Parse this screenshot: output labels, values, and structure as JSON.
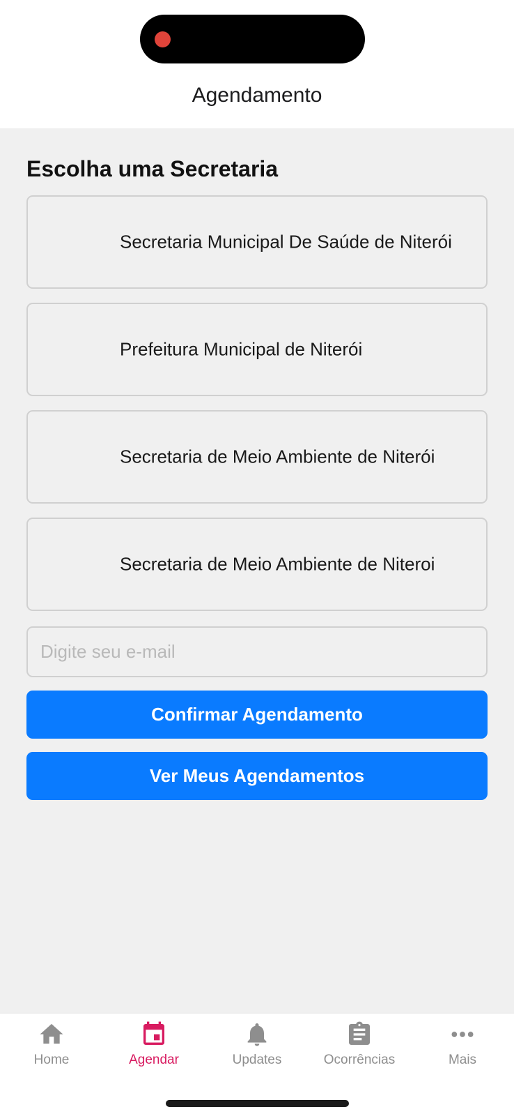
{
  "header": {
    "title": "Agendamento"
  },
  "main": {
    "section_title": "Escolha uma Secretaria",
    "secretarias": [
      {
        "label": "Secretaria Municipal De Saúde de Niterói"
      },
      {
        "label": "Prefeitura Municipal de Niterói"
      },
      {
        "label": "Secretaria de Meio Ambiente de Niterói"
      },
      {
        "label": "Secretaria de Meio Ambiente de Niteroi"
      }
    ],
    "email": {
      "value": "",
      "placeholder": "Digite seu e-mail"
    },
    "confirm_label": "Confirmar Agendamento",
    "view_label": "Ver Meus Agendamentos"
  },
  "tabbar": {
    "active": "Agendar",
    "active_color": "#d81b60",
    "inactive_color": "#8e8e8e",
    "tabs": [
      {
        "label": "Home",
        "icon": "home-icon"
      },
      {
        "label": "Agendar",
        "icon": "calendar-icon"
      },
      {
        "label": "Updates",
        "icon": "bell-icon"
      },
      {
        "label": "Ocorrências",
        "icon": "clipboard-icon"
      },
      {
        "label": "Mais",
        "icon": "more-icon"
      }
    ]
  },
  "colors": {
    "accent": "#0a7bff",
    "background": "#f0f0f0",
    "recording_dot": "#e0443a"
  }
}
